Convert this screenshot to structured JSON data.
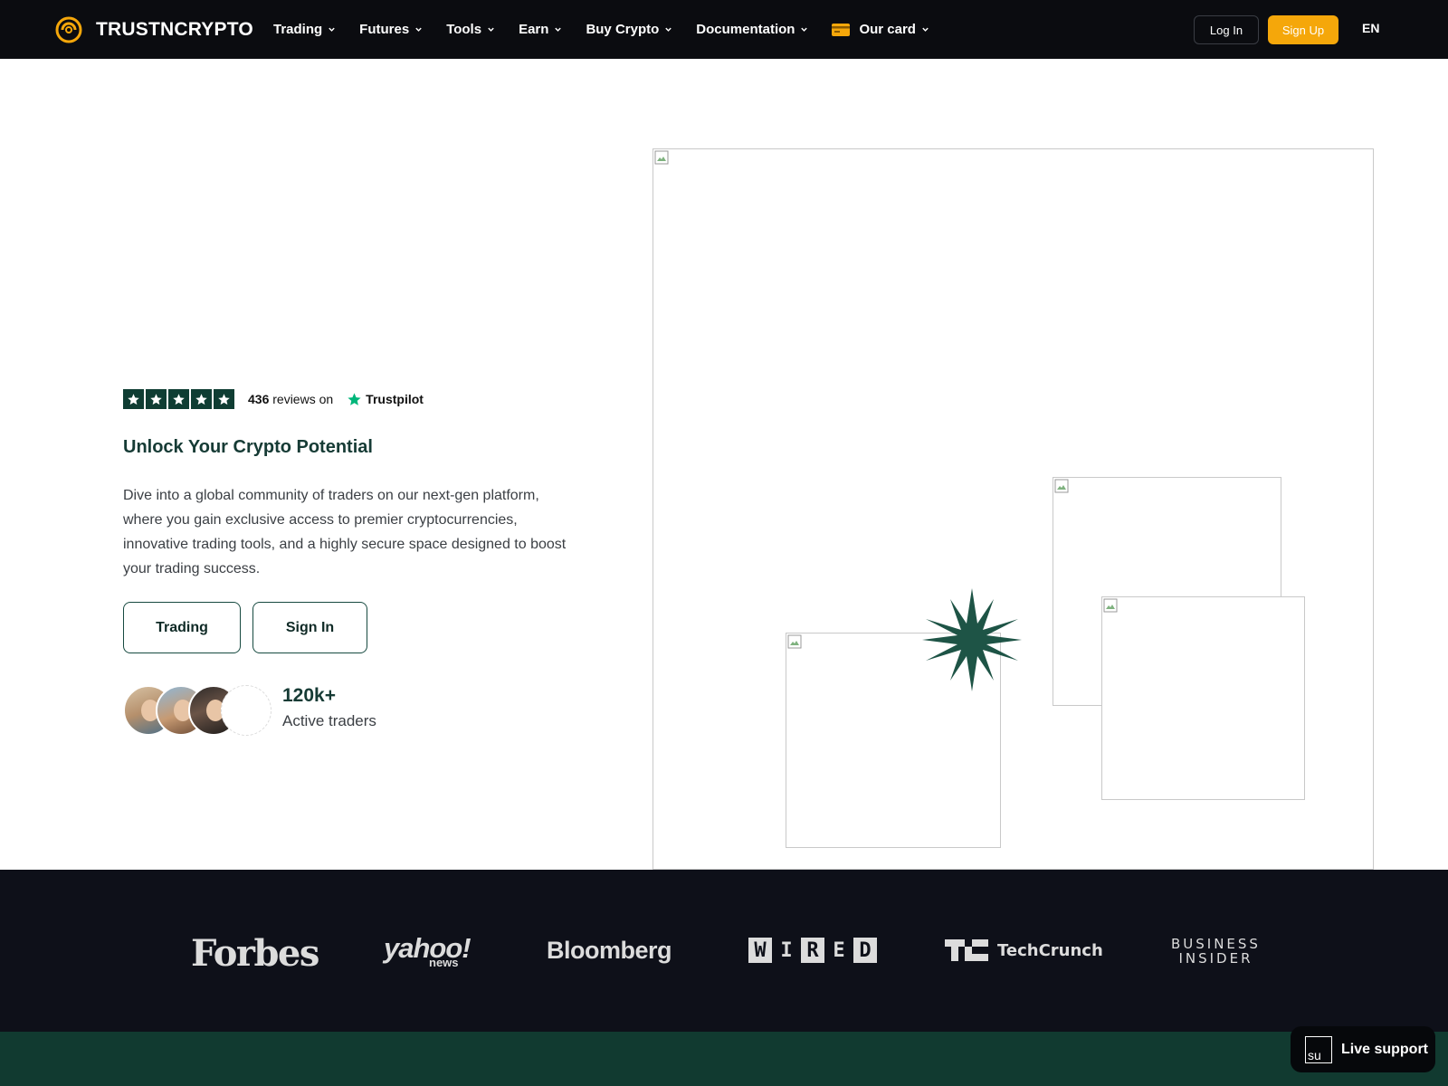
{
  "brand": {
    "name": "TRUSTNCRYPTO"
  },
  "nav": {
    "items": [
      {
        "label": "Trading"
      },
      {
        "label": "Futures"
      },
      {
        "label": "Tools"
      },
      {
        "label": "Earn"
      },
      {
        "label": "Buy Crypto"
      },
      {
        "label": "Documentation"
      },
      {
        "label": "Our card"
      }
    ],
    "login_label": "Log In",
    "signup_label": "Sign Up",
    "language": "EN"
  },
  "hero": {
    "rating_stars": 5,
    "review_count": "436",
    "reviews_text": "reviews on",
    "trustpilot_label": "Trustpilot",
    "title": "Unlock Your Crypto Potential",
    "description": "Dive into a global community of traders on our next-gen platform, where you gain exclusive access to premier cryptocurrencies, innovative trading tools, and a highly secure space designed to boost your trading success.",
    "primary_button": "Trading",
    "secondary_button": "Sign In",
    "stat_value": "120k+",
    "stat_label": "Active traders"
  },
  "press": {
    "logos": [
      "Forbes",
      "yahoo!",
      "news",
      "Bloomberg",
      "WIRED",
      "TechCrunch",
      "BUSINESS",
      "INSIDER"
    ]
  },
  "live_support": {
    "icon_alt": "su",
    "label": "Live support"
  },
  "colors": {
    "nav_bg": "#0b0c10",
    "accent": "#f5a70a",
    "brand_green": "#0f3d33",
    "press_bg": "#0e1019",
    "footer_green": "#113a30"
  }
}
